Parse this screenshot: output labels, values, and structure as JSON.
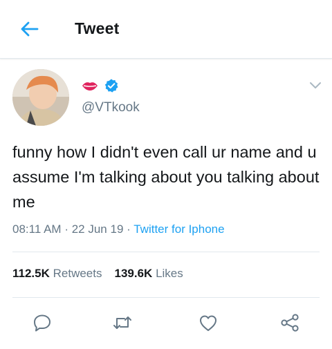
{
  "header": {
    "title": "Tweet",
    "back_icon": "arrow-left-icon"
  },
  "author": {
    "display_name_icons": [
      "lips-emoji-icon",
      "verified-badge-icon"
    ],
    "handle": "@VTkook"
  },
  "tweet": {
    "text": "funny how I didn't even call ur name and u assume I'm talking about you talking about me",
    "time": "08:11 AM",
    "separator": "·",
    "date": "22 Jun 19",
    "source": "Twitter for Iphone"
  },
  "stats": {
    "retweets_count": "112.5K",
    "retweets_label": "Retweets",
    "likes_count": "139.6K",
    "likes_label": "Likes"
  },
  "actions": [
    "reply-icon",
    "retweet-icon",
    "like-icon",
    "share-icon"
  ],
  "colors": {
    "accent": "#1da1f2",
    "secondary_text": "#657786",
    "divider": "#e1e8ed",
    "text": "#14171a"
  }
}
